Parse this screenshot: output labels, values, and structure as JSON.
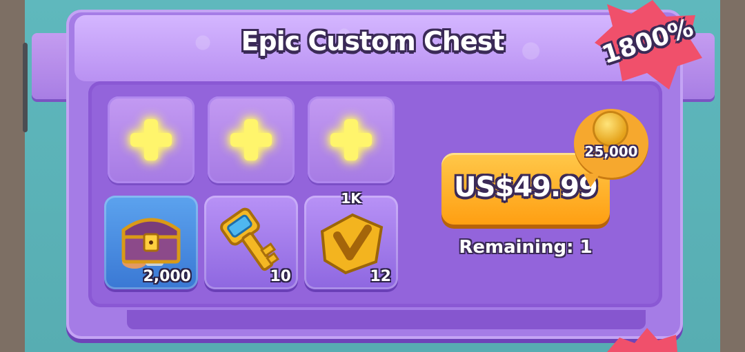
{
  "offer": {
    "title": "Epic Custom Chest",
    "badge": "1800%",
    "price_button_label": "US$49.99",
    "bonus_coins": "25,000",
    "remaining": "Remaining: 1"
  },
  "custom_slots": [
    {
      "state": "empty",
      "icon": "plus-icon"
    },
    {
      "state": "empty",
      "icon": "plus-icon"
    },
    {
      "state": "empty",
      "icon": "plus-icon"
    }
  ],
  "rewards": [
    {
      "icon": "treasure-chest-icon",
      "count": "2,000",
      "tag": ""
    },
    {
      "icon": "golden-key-icon",
      "count": "10",
      "tag": ""
    },
    {
      "icon": "gold-chevron-badge-icon",
      "count": "12",
      "tag": "1K"
    }
  ],
  "colors": {
    "panel": "#a57ce6",
    "inner": "#9364db",
    "button": "#ff9f12",
    "badge": "#f0506b",
    "plus": "#fff56c"
  }
}
